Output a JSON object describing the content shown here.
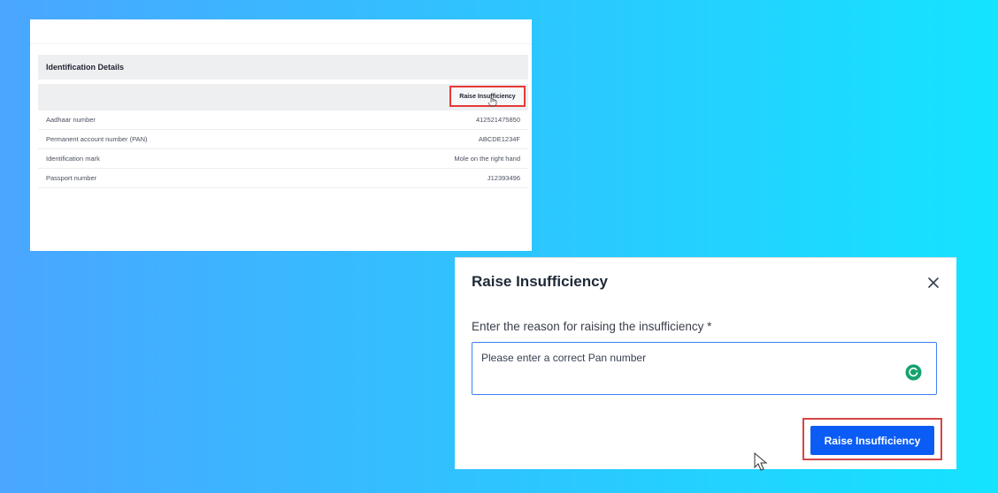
{
  "details_panel": {
    "section_title": "Identification Details",
    "raise_button_label": "Raise Insufficiency",
    "rows": [
      {
        "label": "Aadhaar number",
        "value": "412521475850"
      },
      {
        "label": "Permanent account number (PAN)",
        "value": "ABCDE1234F"
      },
      {
        "label": "Identification mark",
        "value": "Mole on the right hand"
      },
      {
        "label": "Passport number",
        "value": "J12393496"
      }
    ]
  },
  "modal": {
    "title": "Raise Insufficiency",
    "field_label": "Enter the reason for raising the insufficiency *",
    "reason_value": "Please enter a correct Pan number",
    "submit_label": "Raise Insufficiency",
    "close_icon": "close-icon",
    "assistant_icon": "grammarly-icon"
  },
  "colors": {
    "accent": "#0a5cf5",
    "highlight": "#e53935",
    "assistant": "#15a36e"
  }
}
